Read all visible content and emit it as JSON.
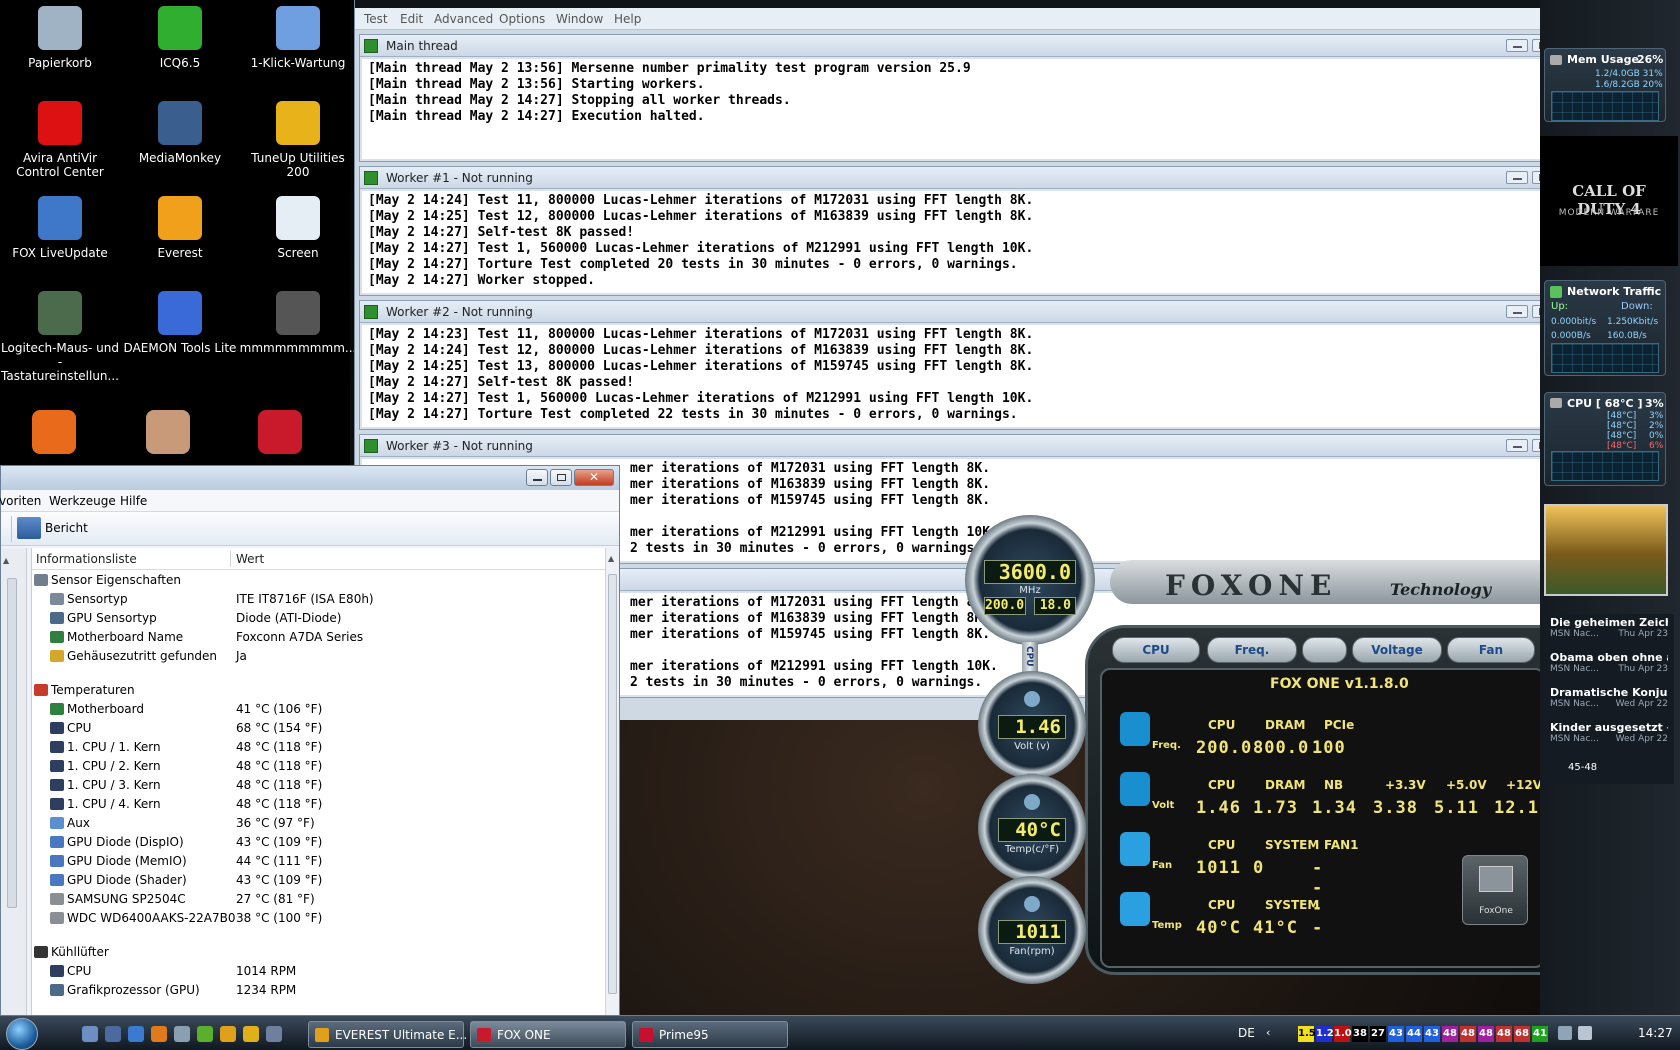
{
  "desktop_icons": [
    {
      "label": "Papierkorb",
      "icon": "recycle-bin-icon"
    },
    {
      "label": "ICQ6.5",
      "icon": "icq-flower-icon"
    },
    {
      "label": "1-Klick-Wartung",
      "icon": "maintenance-icon"
    },
    {
      "label": "Avira AntiVir Control Center",
      "icon": "avira-umbrella-icon"
    },
    {
      "label": "MediaMonkey",
      "icon": "mediamonkey-icon"
    },
    {
      "label": "TuneUp Utilities 200",
      "icon": "tuneup-icon"
    },
    {
      "label": "FOX LiveUpdate",
      "icon": "fox-liveupdate-icon"
    },
    {
      "label": "Everest",
      "icon": "everest-info-icon"
    },
    {
      "label": "Screen",
      "icon": "screen-icon"
    },
    {
      "label": "Logitech-Maus- und -Tastatureinstellun...",
      "icon": "logitech-mouse-icon"
    },
    {
      "label": "DAEMON Tools Lite",
      "icon": "daemon-tools-icon"
    },
    {
      "label": "mmmmmmmmm...",
      "icon": "amd-phenom-icon"
    }
  ],
  "prime95": {
    "menu": [
      "Test",
      "Edit",
      "Advanced",
      "Options",
      "Window",
      "Help"
    ],
    "windows": [
      {
        "title": "Main thread",
        "lines": [
          "[Main thread May 2 13:56] Mersenne number primality test program version 25.9",
          "[Main thread May 2 13:56] Starting workers.",
          "[Main thread May 2 14:27] Stopping all worker threads.",
          "[Main thread May 2 14:27] Execution halted."
        ]
      },
      {
        "title": "Worker #1 - Not running",
        "lines": [
          "[May 2 14:24] Test 11, 800000 Lucas-Lehmer iterations of M172031 using FFT length 8K.",
          "[May 2 14:25] Test 12, 800000 Lucas-Lehmer iterations of M163839 using FFT length 8K.",
          "[May 2 14:27] Self-test 8K passed!",
          "[May 2 14:27] Test 1, 560000 Lucas-Lehmer iterations of M212991 using FFT length 10K.",
          "[May 2 14:27] Torture Test completed 20 tests in 30 minutes - 0 errors, 0 warnings.",
          "[May 2 14:27] Worker stopped."
        ]
      },
      {
        "title": "Worker #2 - Not running",
        "lines": [
          "[May 2 14:23] Test 11, 800000 Lucas-Lehmer iterations of M172031 using FFT length 8K.",
          "[May 2 14:24] Test 12, 800000 Lucas-Lehmer iterations of M163839 using FFT length 8K.",
          "[May 2 14:25] Test 13, 800000 Lucas-Lehmer iterations of M159745 using FFT length 8K.",
          "[May 2 14:27] Self-test 8K passed!",
          "[May 2 14:27] Test 1, 560000 Lucas-Lehmer iterations of M212991 using FFT length 10K.",
          "[May 2 14:27] Torture Test completed 22 tests in 30 minutes - 0 errors, 0 warnings."
        ]
      },
      {
        "title": "Worker #3 - Not running",
        "lines": [
          "mer iterations of M172031 using FFT length 8K.",
          "mer iterations of M163839 using FFT length 8K.",
          "mer iterations of M159745 using FFT length 8K.",
          "",
          "mer iterations of M212991 using FFT length 10K.",
          "2 tests in 30 minutes - 0 errors, 0 warnings."
        ]
      },
      {
        "title": "",
        "lines": [
          "mer iterations of M172031 using FFT length 8K.",
          "mer iterations of M163839 using FFT length 8K.",
          "mer iterations of M159745 using FFT length 8K.",
          "",
          "mer iterations of M212991 using FFT length 10K.",
          "2 tests in 30 minutes - 0 errors, 0 warnings."
        ]
      }
    ]
  },
  "everest": {
    "menu": [
      "voriten",
      "Werkzeuge",
      "Hilfe"
    ],
    "toolbar_label": "Bericht",
    "col_info": "Informationsliste",
    "col_value": "Wert",
    "rows": [
      {
        "type": "group",
        "label": "Sensor Eigenschaften",
        "icon": "sensor-group-icon"
      },
      {
        "type": "item",
        "label": "Sensortyp",
        "value": "ITE IT8716F  (ISA E80h)",
        "icon": "sensor-chip-icon"
      },
      {
        "type": "item",
        "label": "GPU Sensortyp",
        "value": "Diode  (ATI-Diode)",
        "icon": "gpu-chip-icon"
      },
      {
        "type": "item",
        "label": "Motherboard Name",
        "value": "Foxconn A7DA Series",
        "icon": "motherboard-icon"
      },
      {
        "type": "item",
        "label": "Gehäusezutritt gefunden",
        "value": "Ja",
        "icon": "lock-icon"
      },
      {
        "type": "spacer"
      },
      {
        "type": "group",
        "label": "Temperaturen",
        "icon": "thermometer-icon"
      },
      {
        "type": "item",
        "label": "Motherboard",
        "value": "41 °C  (106 °F)",
        "icon": "motherboard-icon"
      },
      {
        "type": "item",
        "label": "CPU",
        "value": "68 °C  (154 °F)",
        "icon": "cpu-icon"
      },
      {
        "type": "item",
        "label": "1. CPU / 1. Kern",
        "value": "48 °C  (118 °F)",
        "icon": "cpu-icon"
      },
      {
        "type": "item",
        "label": "1. CPU / 2. Kern",
        "value": "48 °C  (118 °F)",
        "icon": "cpu-icon"
      },
      {
        "type": "item",
        "label": "1. CPU / 3. Kern",
        "value": "48 °C  (118 °F)",
        "icon": "cpu-icon"
      },
      {
        "type": "item",
        "label": "1. CPU / 4. Kern",
        "value": "48 °C  (118 °F)",
        "icon": "cpu-icon"
      },
      {
        "type": "item",
        "label": "Aux",
        "value": "36 °C  (97 °F)",
        "icon": "aux-sensor-icon"
      },
      {
        "type": "item",
        "label": "GPU Diode (DispIO)",
        "value": "43 °C  (109 °F)",
        "icon": "gpu-diode-icon"
      },
      {
        "type": "item",
        "label": "GPU Diode (MemIO)",
        "value": "44 °C  (111 °F)",
        "icon": "gpu-diode-icon"
      },
      {
        "type": "item",
        "label": "GPU Diode (Shader)",
        "value": "43 °C  (109 °F)",
        "icon": "gpu-diode-icon"
      },
      {
        "type": "item",
        "label": "SAMSUNG SP2504C",
        "value": "27 °C  (81 °F)",
        "icon": "hard-disk-icon"
      },
      {
        "type": "item",
        "label": "WDC WD6400AAKS-22A7B0",
        "value": "38 °C  (100 °F)",
        "icon": "hard-disk-icon"
      },
      {
        "type": "spacer"
      },
      {
        "type": "group",
        "label": "Kühllüfter",
        "icon": "fan-icon"
      },
      {
        "type": "item",
        "label": "CPU",
        "value": "1014 RPM",
        "icon": "cpu-icon"
      },
      {
        "type": "item",
        "label": "Grafikprozessor (GPU)",
        "value": "1234 RPM",
        "icon": "gpu-chip-icon"
      }
    ]
  },
  "foxone": {
    "logo": "FOXONE",
    "tech": "Technology",
    "version": "FOX ONE   v1.1.8.0",
    "tabs": [
      "CPU",
      "Freq.",
      "",
      "Voltage",
      "Fan"
    ],
    "orbs": {
      "freq_main": "3600.0",
      "freq_unit": "MHz",
      "freq_fsb": "200.0",
      "freq_mult": "18.0",
      "volt": "1.46",
      "volt_cap": "Volt (v)",
      "temp": "40°C",
      "temp_cap": "Temp(c/°F)",
      "fan": "1011",
      "fan_cap": "Fan(rpm)",
      "cpu_tag": "CPU"
    },
    "freq": {
      "side": "Freq.",
      "labels": [
        "CPU",
        "DRAM",
        "PCIe"
      ],
      "values": [
        "200.0",
        "800.0",
        "100"
      ]
    },
    "volt": {
      "side": "Volt",
      "labels": [
        "CPU",
        "DRAM",
        "NB",
        "+3.3V",
        "+5.0V",
        "+12V"
      ],
      "values": [
        "1.46",
        "1.73",
        "1.34",
        "3.38",
        "5.11",
        "12.1"
      ]
    },
    "fan": {
      "side": "Fan",
      "labels": [
        "CPU",
        "SYSTEM",
        "FAN1"
      ],
      "values": [
        "1011",
        "0",
        "----"
      ]
    },
    "temp": {
      "side": "Temp",
      "labels": [
        "CPU",
        "SYSTEM"
      ],
      "values": [
        "40°C",
        "41°C"
      ]
    },
    "badge": "FoxOne"
  },
  "gadgets": {
    "mem": {
      "title": "Mem Usage",
      "pct": "26%",
      "l1": "1.2/4.0GB  31%",
      "l2": "1.6/8.2GB  20%"
    },
    "game": {
      "line1": "CALL OF DUTY 4",
      "line2": "MODERN WARFARE"
    },
    "net": {
      "title": "Network Traffic",
      "up": "Up:",
      "down": "Down:",
      "l1a": "0.000bit/s",
      "l1b": "1.250Kbit/s",
      "l2a": "0.000B/s",
      "l2b": "160.0B/s"
    },
    "cpu": {
      "title": "CPU [ 68°C ]",
      "pct": "3%",
      "cores": [
        [
          "[48°C]",
          "3%"
        ],
        [
          "[48°C]",
          "2%"
        ],
        [
          "[48°C]",
          "0%"
        ],
        [
          "[48°C]",
          "6%"
        ]
      ]
    },
    "news": [
      {
        "title": "Die geheimen Zeiche...",
        "src": "MSN Nac...",
        "date": "Thu Apr 23"
      },
      {
        "title": "Obama oben ohne a...",
        "src": "MSN Nac...",
        "date": "Thu Apr 23"
      },
      {
        "title": "Dramatische Konjun...",
        "src": "MSN Nac...",
        "date": "Wed Apr 22"
      },
      {
        "title": "Kinder ausgesetzt – ...",
        "src": "MSN Nac...",
        "date": "Wed Apr 22"
      }
    ],
    "news_pager": "45-48"
  },
  "taskbar": {
    "buttons": [
      {
        "label": "EVEREST Ultimate E...",
        "icon": "everest-info-icon"
      },
      {
        "label": "FOX ONE",
        "icon": "fox-one-icon"
      },
      {
        "label": "Prime95",
        "icon": "prime95-icon"
      }
    ],
    "lang": "DE",
    "tray_nums": [
      "1.5",
      "1.2",
      "1.0",
      "38",
      "27",
      "43",
      "44",
      "43",
      "48",
      "48",
      "48",
      "48",
      "68",
      "41"
    ],
    "clock": "14:27"
  }
}
